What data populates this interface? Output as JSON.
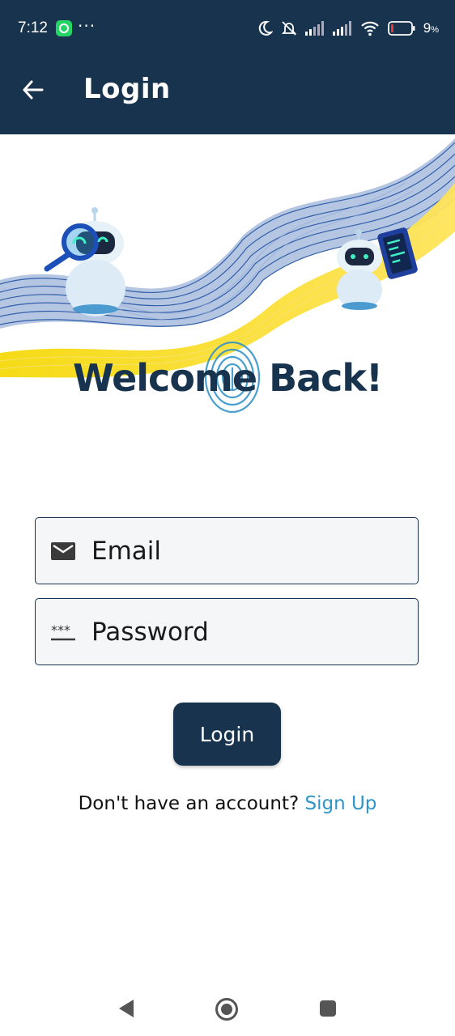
{
  "status_bar": {
    "time": "7:12",
    "dots": "···",
    "battery_percent": "9",
    "battery_unit": "%",
    "icons": [
      "whatsapp-icon",
      "moon-icon",
      "bell-muted-icon",
      "signal-icon",
      "signal-icon",
      "wifi-icon",
      "battery-icon"
    ]
  },
  "app_bar": {
    "title": "Login",
    "back_icon": "arrow-left-icon",
    "color": "#17334d"
  },
  "hero": {
    "welcome": "Welcome Back!"
  },
  "form": {
    "email": {
      "placeholder": "Email",
      "value": "",
      "icon": "mail-icon"
    },
    "password": {
      "placeholder": "Password",
      "value": "",
      "icon": "password-icon"
    },
    "login_label": "Login"
  },
  "signup": {
    "prompt": "Don't have an account?",
    "link": "Sign Up",
    "link_color": "#2f95c8"
  },
  "nav_bar": {
    "icons": [
      "nav-back-icon",
      "nav-home-icon",
      "nav-recents-icon"
    ]
  }
}
